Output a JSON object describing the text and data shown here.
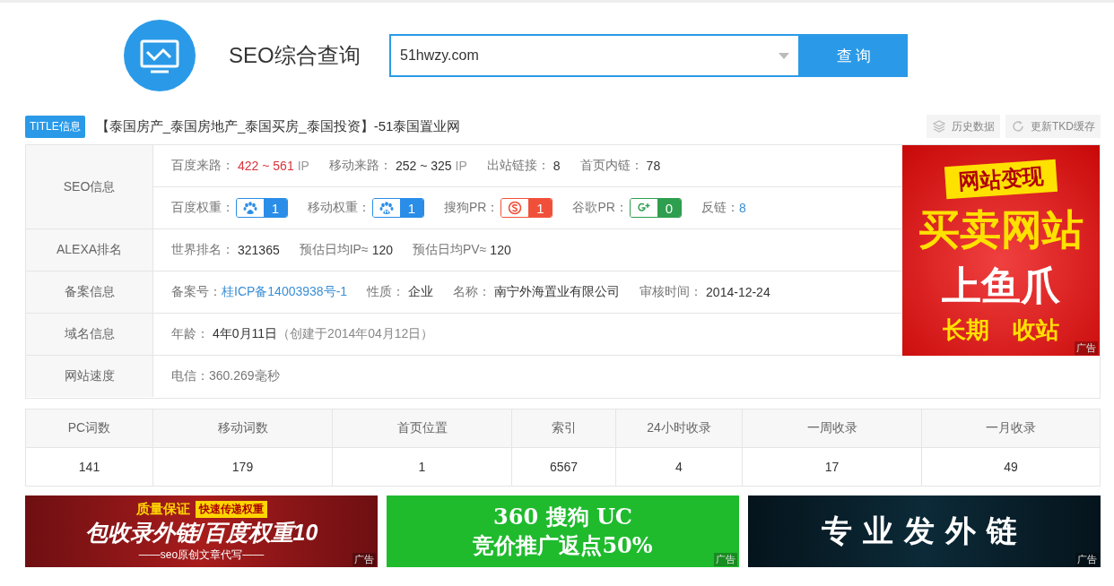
{
  "header": {
    "title": "SEO综合查询",
    "search": {
      "value": "51hwzy.com"
    },
    "button": "查 询"
  },
  "title_bar": {
    "badge": "TITLE信息",
    "title": "【泰国房产_泰国房地产_泰国买房_泰国投资】-51泰国置业网",
    "actions": [
      {
        "kind": "history",
        "label": "历史数据"
      },
      {
        "kind": "refresh",
        "label": "更新TKD缓存"
      }
    ]
  },
  "info_table": [
    {
      "label": "SEO信息",
      "lines": [
        [
          {
            "kind": "alert",
            "label": "百度来路：",
            "value": "422 ~ 561",
            "unit": "IP"
          },
          {
            "kind": "plain",
            "label": "移动来路：",
            "value": "252 ~ 325",
            "unit": "IP"
          },
          {
            "kind": "plain",
            "label": "出站链接：",
            "value": "8"
          },
          {
            "kind": "plain",
            "label": "首页内链：",
            "value": "78"
          }
        ],
        [
          {
            "kind": "baidu",
            "label": "百度权重：",
            "value": "1"
          },
          {
            "kind": "mobile",
            "label": "移动权重：",
            "value": "1"
          },
          {
            "kind": "sogou",
            "label": "搜狗PR：",
            "value": "1"
          },
          {
            "kind": "google",
            "label": "谷歌PR：",
            "value": "0"
          },
          {
            "kind": "link",
            "label": "反链：",
            "value": "8"
          }
        ]
      ]
    },
    {
      "label": "ALEXA排名",
      "lines": [
        [
          {
            "kind": "plain",
            "label": "世界排名：",
            "value": "321365"
          },
          {
            "kind": "plain",
            "label": "预估日均IP≈",
            "value": "120"
          },
          {
            "kind": "plain",
            "label": "预估日均PV≈",
            "value": "120"
          }
        ]
      ]
    },
    {
      "label": "备案信息",
      "lines": [
        [
          {
            "kind": "link",
            "label": "备案号：",
            "value": "桂ICP备14003938号-1"
          },
          {
            "kind": "plain",
            "label": "性质：",
            "value": "企业"
          },
          {
            "kind": "plain",
            "label": "名称：",
            "value": "南宁外海置业有限公司"
          },
          {
            "kind": "plain",
            "label": "审核时间：",
            "value": "2014-12-24"
          }
        ]
      ]
    },
    {
      "label": "域名信息",
      "lines": [
        [
          {
            "kind": "plain",
            "label": "年龄：",
            "value": "4年0月11日",
            "note": "（创建于2014年04月12日）"
          }
        ]
      ]
    },
    {
      "label": "网站速度",
      "lines": [
        [
          {
            "kind": "muted",
            "label": "电信：",
            "value": "360.269毫秒"
          }
        ]
      ]
    }
  ],
  "side_ad": {
    "lines": [
      "网站变现",
      "买卖网站",
      "上鱼爪",
      "长期",
      "收站"
    ],
    "tag": "广告"
  },
  "stats": {
    "columns": [
      "PC词数",
      "移动词数",
      "首页位置",
      "索引",
      "24小时收录",
      "一周收录",
      "一月收录"
    ],
    "values": [
      "141",
      "179",
      "1",
      "6567",
      "4",
      "17",
      "49"
    ]
  },
  "banners": [
    {
      "kind": "red",
      "lines": [
        "质量保证",
        "快速传递权重",
        "包收录外链/百度权重10",
        "——seo原创文章代写——"
      ],
      "tag": "广告"
    },
    {
      "kind": "green",
      "lines": [
        "360 搜狗 UC",
        "竞价推广返点50%"
      ],
      "tag": "广告"
    },
    {
      "kind": "dark",
      "lines": [
        "专业发外链"
      ],
      "tag": "广告"
    }
  ]
}
